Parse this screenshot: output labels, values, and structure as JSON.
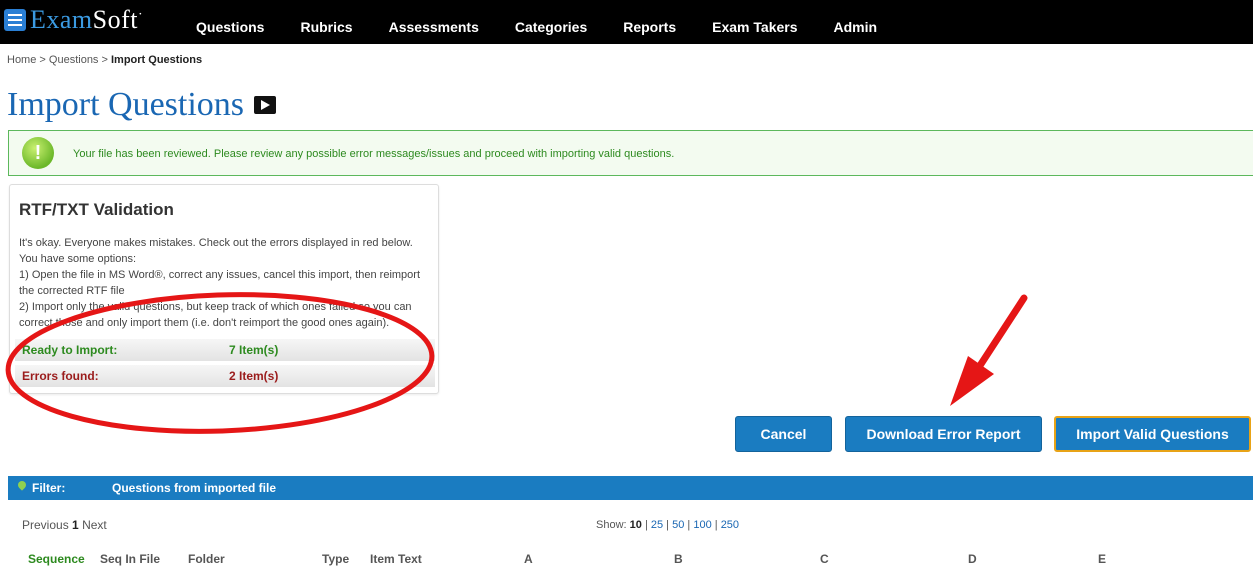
{
  "app": {
    "logo_exam": "Exam",
    "logo_soft": "Soft",
    "logo_mark": "·"
  },
  "nav": {
    "items": [
      "Questions",
      "Rubrics",
      "Assessments",
      "Categories",
      "Reports",
      "Exam Takers",
      "Admin"
    ]
  },
  "breadcrumb": {
    "home": "Home",
    "sep1": ">",
    "questions": "Questions",
    "sep2": ">",
    "current": "Import Questions"
  },
  "page": {
    "title": "Import Questions"
  },
  "notice": {
    "icon": "!",
    "text": "Your file has been reviewed. Please review any possible error messages/issues and proceed with importing valid questions."
  },
  "validation": {
    "title": "RTF/TXT Validation",
    "lines": [
      "It's okay. Everyone makes mistakes. Check out the errors displayed in red below.",
      "You have some options:",
      "1) Open the file in MS Word®, correct any issues, cancel this import, then reimport",
      "the corrected RTF file",
      "2) Import only the valid questions, but keep track of which ones failed so you can",
      "correct those and only import them (i.e. don't reimport the good ones again)."
    ],
    "ready_label": "Ready to Import:",
    "ready_value": "7 Item(s)",
    "errors_label": "Errors found:",
    "errors_value": "2 Item(s)"
  },
  "buttons": {
    "cancel": "Cancel",
    "download": "Download Error Report",
    "import": "Import Valid Questions"
  },
  "filter": {
    "label": "Filter:",
    "value": "Questions from imported file"
  },
  "pager": {
    "previous": "Previous",
    "page": "1",
    "next": "Next"
  },
  "show": {
    "label": "Show:",
    "options": [
      "10",
      "25",
      "50",
      "100",
      "250"
    ],
    "selected": "10"
  },
  "table": {
    "headers": [
      "Sequence",
      "Seq In File",
      "Folder",
      "Type",
      "Item Text",
      "A",
      "B",
      "C",
      "D",
      "E"
    ]
  },
  "colors": {
    "accent_blue": "#1a7cc1",
    "title_blue": "#1a67b3",
    "success_green": "#2d8a1f",
    "error_red": "#9b1c1c",
    "annotation_red": "#e51616"
  }
}
